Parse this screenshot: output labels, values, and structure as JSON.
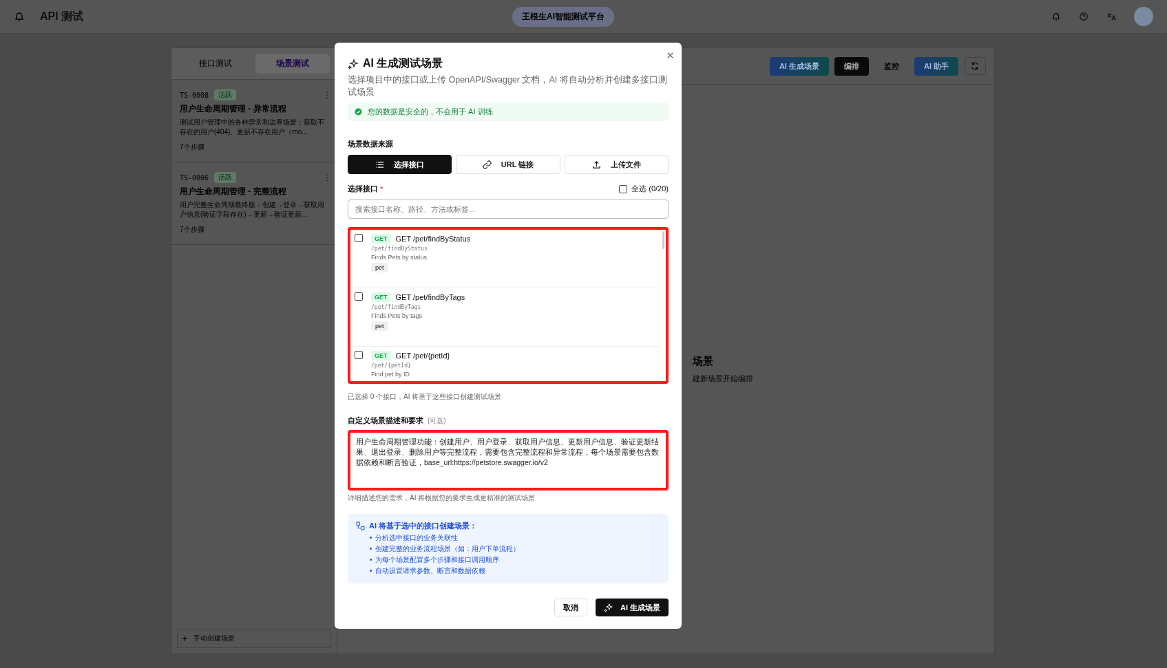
{
  "header": {
    "title": "API 测试",
    "platform": "王根生AI智能测试平台"
  },
  "sidebar": {
    "tabs": [
      {
        "label": "接口测试",
        "selected": false
      },
      {
        "label": "场景测试",
        "selected": true
      }
    ],
    "scenarios": [
      {
        "id": "TS-0008",
        "status": "活跃",
        "title": "用户生命周期管理 - 异常流程",
        "description": "测试用户管理中的各种异常和边界场景：获取不存在的用户(404)、更新不存在用户（mo...",
        "steps": "7个步骤"
      },
      {
        "id": "TS-0006",
        "status": "活跃",
        "title": "用户生命周期管理 - 完整流程",
        "description": "用户完整生命周期最终版：创建→登录→获取用户信息(验证字段存在)→更新→验证更新...",
        "steps": "7个步骤"
      }
    ],
    "create_button": "手动创建场景"
  },
  "toolbar": {
    "buttons": [
      {
        "label": "AI 生成场景",
        "kind": "ai"
      },
      {
        "label": "编排",
        "kind": "dark"
      },
      {
        "label": "监控",
        "kind": "plain"
      },
      {
        "label": "AI 助手",
        "kind": "assistant"
      }
    ]
  },
  "empty_state": {
    "title": "场景",
    "hint": "建新场景开始编排"
  },
  "dialog": {
    "title": "AI 生成测试场景",
    "description": "选择项目中的接口或上传 OpenAPI/Swagger 文档，AI 将自动分析并创建多接口测试场景",
    "security_notice": "您的数据是安全的，不会用于 AI 训练",
    "source_label": "场景数据来源",
    "source_tabs": [
      {
        "label": "选择接口",
        "kind": "list",
        "selected": true
      },
      {
        "label": "URL 链接",
        "kind": "link",
        "selected": false
      },
      {
        "label": "上传文件",
        "kind": "upload",
        "selected": false
      }
    ],
    "select_label": "选择接口",
    "required_mark": "*",
    "select_all": {
      "label": "全选 (0/20)",
      "checked": false
    },
    "search": {
      "placeholder": "搜索接口名称、路径、方法或标签..."
    },
    "endpoints": [
      {
        "method": "GET",
        "name": "GET /pet/findByStatus",
        "path": "/pet/findByStatus",
        "summary": "Finds Pets by status",
        "tag": "pet",
        "checked": false
      },
      {
        "method": "GET",
        "name": "GET /pet/findByTags",
        "path": "/pet/findByTags",
        "summary": "Finds Pets by tags",
        "tag": "pet",
        "checked": false
      },
      {
        "method": "GET",
        "name": "GET /pet/{petId}",
        "path": "/pet/{petId}",
        "summary": "Find pet by ID",
        "checked": false
      }
    ],
    "endpoints_highlighted": true,
    "selection_hint": "已选择 0 个接口，AI 将基于这些接口创建测试场景",
    "custom_label": "自定义场景描述和要求",
    "custom_optional": "(可选)",
    "custom_value": "用户生命周期管理功能：创建用户、用户登录、获取用户信息、更新用户信息、验证更新结果、退出登录、删除用户等完整流程，需要包含完整流程和异常流程，每个场景需要包含数据依赖和断言验证，base_url:https://petstore.swagger.io/v2",
    "custom_highlighted": true,
    "custom_hint": "详细描述您的需求，AI 将根据您的要求生成更精准的测试场景",
    "info": {
      "title": "AI 将基于选中的接口创建场景：",
      "bullets": [
        "分析选中接口的业务关联性",
        "创建完整的业务流程场景（如：用户下单流程）",
        "为每个场景配置多个步骤和接口调用顺序",
        "自动设置请求参数、断言和数据依赖"
      ]
    },
    "cancel": "取消",
    "generate": "AI 生成场景"
  }
}
